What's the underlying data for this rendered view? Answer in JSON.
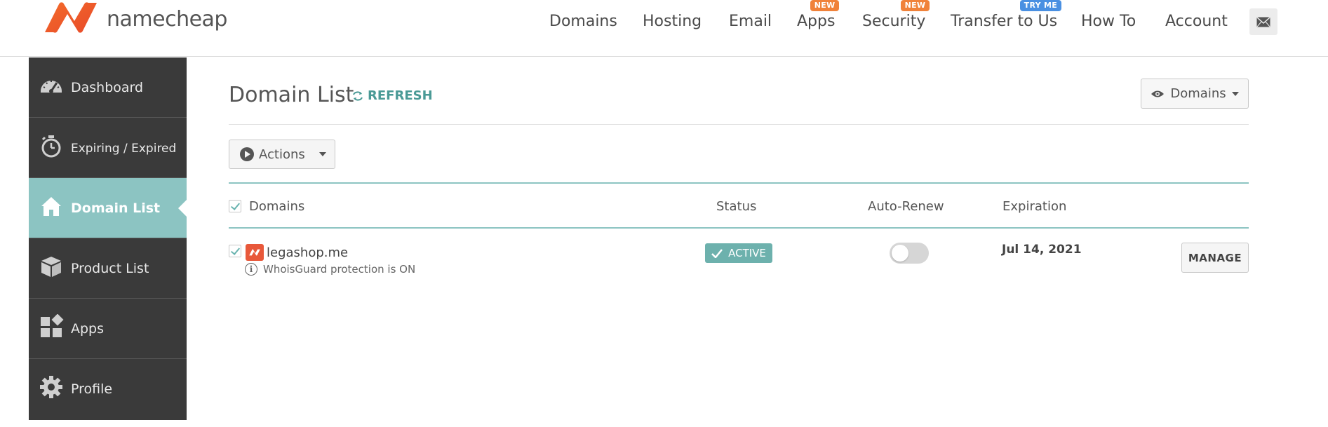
{
  "header": {
    "logo_text": "namecheap",
    "nav": [
      {
        "label": "Domains",
        "badge": null
      },
      {
        "label": "Hosting",
        "badge": null
      },
      {
        "label": "Email",
        "badge": null
      },
      {
        "label": "Apps",
        "badge": "NEW"
      },
      {
        "label": "Security",
        "badge": "NEW"
      },
      {
        "label": "Transfer to Us",
        "badge": "TRY ME"
      },
      {
        "label": "How To",
        "badge": null
      },
      {
        "label": "Account",
        "badge": null
      }
    ]
  },
  "sidebar": {
    "items": [
      {
        "label": "Dashboard",
        "icon": "speedometer-icon",
        "active": false
      },
      {
        "label": "Expiring / Expired",
        "icon": "stopwatch-icon",
        "active": false
      },
      {
        "label": "Domain List",
        "icon": "home-icon",
        "active": true
      },
      {
        "label": "Product List",
        "icon": "box-icon",
        "active": false
      },
      {
        "label": "Apps",
        "icon": "apps-icon",
        "active": false
      },
      {
        "label": "Profile",
        "icon": "gear-icon",
        "active": false
      }
    ]
  },
  "main": {
    "title": "Domain List",
    "refresh_label": "REFRESH",
    "view_label": "Domains",
    "actions_label": "Actions",
    "table": {
      "columns": [
        "Domains",
        "Status",
        "Auto-Renew",
        "Expiration"
      ],
      "rows": [
        {
          "domain": "legashop.me",
          "note": "WhoisGuard protection is ON",
          "status": "ACTIVE",
          "auto_renew": false,
          "expiration": "Jul 14, 2021",
          "action": "MANAGE"
        }
      ]
    }
  },
  "colors": {
    "brand_orange": "#e8583a",
    "accent_teal": "#8cc4c2",
    "badge_orange": "#f0823a",
    "badge_blue": "#4a90e2",
    "sidebar_bg": "#3a3a3a"
  }
}
